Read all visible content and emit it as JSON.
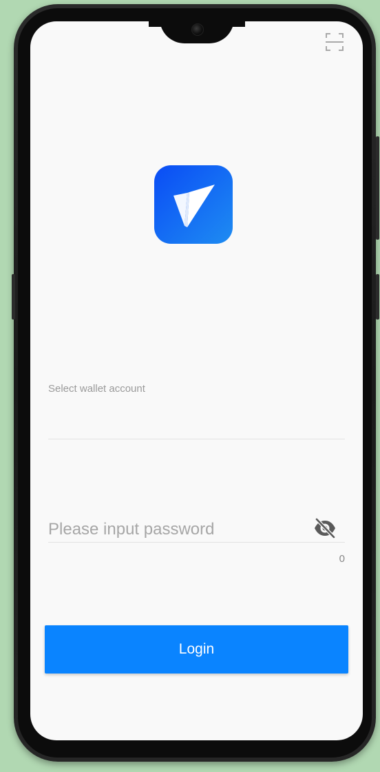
{
  "app": {
    "logo_icon": "paper-plane-logo-icon",
    "brand_gradient": [
      "#0a4cf5",
      "#1e8cf2"
    ]
  },
  "toolbar": {
    "scan_icon": "scan-frame-icon"
  },
  "account": {
    "label": "Select wallet account",
    "value": ""
  },
  "password": {
    "placeholder": "Please input password",
    "value": "",
    "visibility_icon": "eye-off-icon",
    "char_count": "0"
  },
  "login": {
    "label": "Login",
    "color": "#0a84ff"
  }
}
